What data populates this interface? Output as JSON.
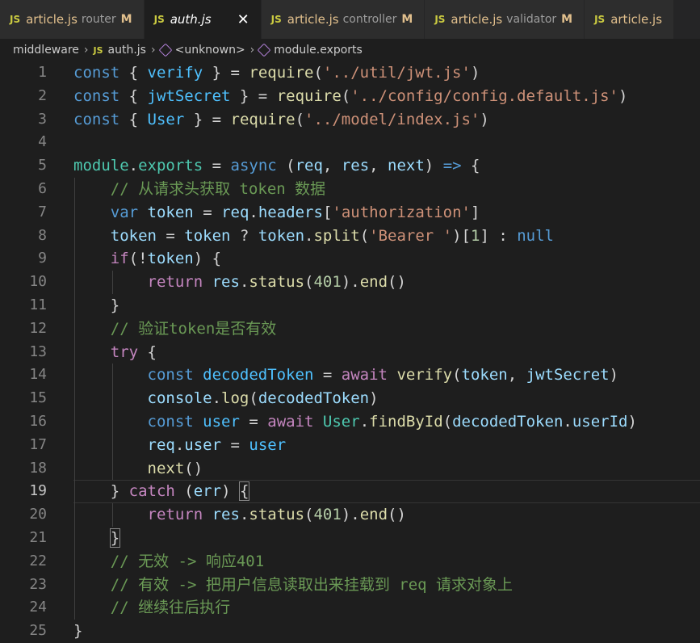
{
  "tabs": [
    {
      "name": "article.js",
      "desc": "router",
      "mod": "M",
      "active": false
    },
    {
      "name": "auth.js",
      "desc": "",
      "mod": "",
      "active": true
    },
    {
      "name": "article.js",
      "desc": "controller",
      "mod": "M",
      "active": false
    },
    {
      "name": "article.js",
      "desc": "validator",
      "mod": "M",
      "active": false
    },
    {
      "name": "article.js",
      "desc": "",
      "mod": "",
      "active": false
    }
  ],
  "tab_icon_label": "JS",
  "close_glyph": "✕",
  "breadcrumb": {
    "folder": "middleware",
    "file": "auth.js",
    "symbol1": "<unknown>",
    "symbol2": "module.exports"
  },
  "current_line": 19,
  "lines": [
    [
      [
        "kw",
        "const"
      ],
      [
        "op",
        " { "
      ],
      [
        "const",
        "verify"
      ],
      [
        "op",
        " } = "
      ],
      [
        "fn",
        "require"
      ],
      [
        "op",
        "("
      ],
      [
        "str",
        "'../util/jwt.js'"
      ],
      [
        "op",
        ")"
      ]
    ],
    [
      [
        "kw",
        "const"
      ],
      [
        "op",
        " { "
      ],
      [
        "const",
        "jwtSecret"
      ],
      [
        "op",
        " } = "
      ],
      [
        "fn",
        "require"
      ],
      [
        "op",
        "("
      ],
      [
        "str",
        "'../config/config.default.js'"
      ],
      [
        "op",
        ")"
      ]
    ],
    [
      [
        "kw",
        "const"
      ],
      [
        "op",
        " { "
      ],
      [
        "const",
        "User"
      ],
      [
        "op",
        " } = "
      ],
      [
        "fn",
        "require"
      ],
      [
        "op",
        "("
      ],
      [
        "str",
        "'../model/index.js'"
      ],
      [
        "op",
        ")"
      ]
    ],
    [],
    [
      [
        "cls",
        "module"
      ],
      [
        "op",
        "."
      ],
      [
        "cls",
        "exports"
      ],
      [
        "op",
        " = "
      ],
      [
        "kw",
        "async"
      ],
      [
        "op",
        " ("
      ],
      [
        "var",
        "req"
      ],
      [
        "op",
        ", "
      ],
      [
        "var",
        "res"
      ],
      [
        "op",
        ", "
      ],
      [
        "var",
        "next"
      ],
      [
        "op",
        ") "
      ],
      [
        "kw",
        "=>"
      ],
      [
        "op",
        " {"
      ]
    ],
    [
      [
        "op",
        "    "
      ],
      [
        "cmt",
        "// 从请求头获取 token 数据"
      ]
    ],
    [
      [
        "op",
        "    "
      ],
      [
        "kw",
        "var"
      ],
      [
        "op",
        " "
      ],
      [
        "var",
        "token"
      ],
      [
        "op",
        " = "
      ],
      [
        "var",
        "req"
      ],
      [
        "op",
        "."
      ],
      [
        "var",
        "headers"
      ],
      [
        "op",
        "["
      ],
      [
        "str",
        "'authorization'"
      ],
      [
        "op",
        "]"
      ]
    ],
    [
      [
        "op",
        "    "
      ],
      [
        "var",
        "token"
      ],
      [
        "op",
        " = "
      ],
      [
        "var",
        "token"
      ],
      [
        "op",
        " ? "
      ],
      [
        "var",
        "token"
      ],
      [
        "op",
        "."
      ],
      [
        "fn",
        "split"
      ],
      [
        "op",
        "("
      ],
      [
        "str",
        "'Bearer '"
      ],
      [
        "op",
        ")["
      ],
      [
        "num",
        "1"
      ],
      [
        "op",
        "] : "
      ],
      [
        "kw",
        "null"
      ]
    ],
    [
      [
        "op",
        "    "
      ],
      [
        "ctrl",
        "if"
      ],
      [
        "op",
        "(!"
      ],
      [
        "var",
        "token"
      ],
      [
        "op",
        ") {"
      ]
    ],
    [
      [
        "op",
        "        "
      ],
      [
        "ctrl",
        "return"
      ],
      [
        "op",
        " "
      ],
      [
        "var",
        "res"
      ],
      [
        "op",
        "."
      ],
      [
        "fn",
        "status"
      ],
      [
        "op",
        "("
      ],
      [
        "num",
        "401"
      ],
      [
        "op",
        ")."
      ],
      [
        "fn",
        "end"
      ],
      [
        "op",
        "()"
      ]
    ],
    [
      [
        "op",
        "    }"
      ]
    ],
    [
      [
        "op",
        "    "
      ],
      [
        "cmt",
        "// 验证token是否有效"
      ]
    ],
    [
      [
        "op",
        "    "
      ],
      [
        "ctrl",
        "try"
      ],
      [
        "op",
        " {"
      ]
    ],
    [
      [
        "op",
        "        "
      ],
      [
        "kw",
        "const"
      ],
      [
        "op",
        " "
      ],
      [
        "const",
        "decodedToken"
      ],
      [
        "op",
        " = "
      ],
      [
        "ctrl",
        "await"
      ],
      [
        "op",
        " "
      ],
      [
        "fn",
        "verify"
      ],
      [
        "op",
        "("
      ],
      [
        "var",
        "token"
      ],
      [
        "op",
        ", "
      ],
      [
        "var",
        "jwtSecret"
      ],
      [
        "op",
        ")"
      ]
    ],
    [
      [
        "op",
        "        "
      ],
      [
        "var",
        "console"
      ],
      [
        "op",
        "."
      ],
      [
        "fn",
        "log"
      ],
      [
        "op",
        "("
      ],
      [
        "var",
        "decodedToken"
      ],
      [
        "op",
        ")"
      ]
    ],
    [
      [
        "op",
        "        "
      ],
      [
        "kw",
        "const"
      ],
      [
        "op",
        " "
      ],
      [
        "const",
        "user"
      ],
      [
        "op",
        " = "
      ],
      [
        "ctrl",
        "await"
      ],
      [
        "op",
        " "
      ],
      [
        "cls",
        "User"
      ],
      [
        "op",
        "."
      ],
      [
        "fn",
        "findById"
      ],
      [
        "op",
        "("
      ],
      [
        "var",
        "decodedToken"
      ],
      [
        "op",
        "."
      ],
      [
        "var",
        "userId"
      ],
      [
        "op",
        ")"
      ]
    ],
    [
      [
        "op",
        "        "
      ],
      [
        "var",
        "req"
      ],
      [
        "op",
        "."
      ],
      [
        "var",
        "user"
      ],
      [
        "op",
        " = "
      ],
      [
        "const",
        "user"
      ]
    ],
    [
      [
        "op",
        "        "
      ],
      [
        "fn",
        "next"
      ],
      [
        "op",
        "()"
      ]
    ],
    [
      [
        "op",
        "    } "
      ],
      [
        "ctrl",
        "catch"
      ],
      [
        "op",
        " ("
      ],
      [
        "var",
        "err"
      ],
      [
        "op",
        ") "
      ],
      [
        "op",
        "{"
      ]
    ],
    [
      [
        "op",
        "        "
      ],
      [
        "ctrl",
        "return"
      ],
      [
        "op",
        " "
      ],
      [
        "var",
        "res"
      ],
      [
        "op",
        "."
      ],
      [
        "fn",
        "status"
      ],
      [
        "op",
        "("
      ],
      [
        "num",
        "401"
      ],
      [
        "op",
        ")."
      ],
      [
        "fn",
        "end"
      ],
      [
        "op",
        "()"
      ]
    ],
    [
      [
        "op",
        "    "
      ],
      [
        "op",
        "}"
      ]
    ],
    [
      [
        "op",
        "    "
      ],
      [
        "cmt",
        "// 无效 -> 响应401"
      ]
    ],
    [
      [
        "op",
        "    "
      ],
      [
        "cmt",
        "// 有效 -> 把用户信息读取出来挂载到 req 请求对象上"
      ]
    ],
    [
      [
        "op",
        "    "
      ],
      [
        "cmt",
        "// 继续往后执行"
      ]
    ],
    [
      [
        "op",
        "}"
      ]
    ]
  ]
}
